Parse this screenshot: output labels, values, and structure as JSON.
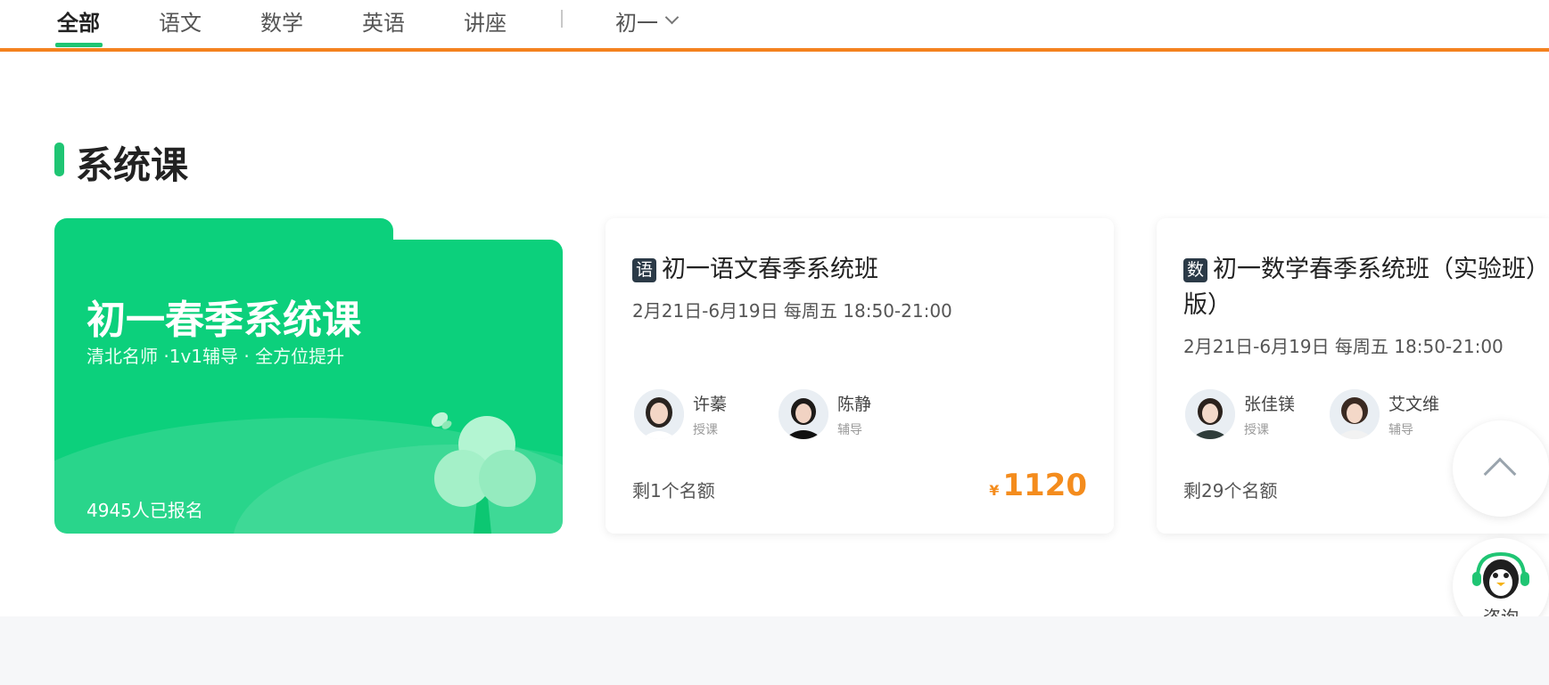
{
  "nav": {
    "tabs": [
      {
        "label": "全部",
        "active": true
      },
      {
        "label": "语文",
        "active": false
      },
      {
        "label": "数学",
        "active": false
      },
      {
        "label": "英语",
        "active": false
      },
      {
        "label": "讲座",
        "active": false
      }
    ],
    "separator": "|",
    "grade": "初一",
    "accent_color": "#f4821f",
    "active_color": "#1fc573"
  },
  "section": {
    "title": "系统课"
  },
  "promo": {
    "title": "初一春季系统课",
    "subtitle": "清北名师 ·1v1辅导 · 全方位提升",
    "enrolled": "4945人已报名",
    "color": "#0cd07c"
  },
  "courses": [
    {
      "subject_badge": "语",
      "title": "初一语文春季系统班",
      "time": "2月21日-6月19日 每周五 18:50-21:00",
      "teachers": [
        {
          "name": "许蓁",
          "role": "授课"
        },
        {
          "name": "陈静",
          "role": "辅导"
        }
      ],
      "seats": "剩1个名额",
      "currency": "¥",
      "price": "1120"
    },
    {
      "subject_badge": "数",
      "title": "初一数学春季系统班（实验班）版）",
      "time": "2月21日-6月19日 每周五 18:50-21:00",
      "teachers": [
        {
          "name": "张佳镁",
          "role": "授课"
        },
        {
          "name": "艾文维",
          "role": "辅导"
        }
      ],
      "seats": "剩29个名额"
    }
  ],
  "float": {
    "consult_label": "咨询",
    "back_to_top_icon": "chevron-up-icon"
  },
  "price_color": "#f48c1d"
}
